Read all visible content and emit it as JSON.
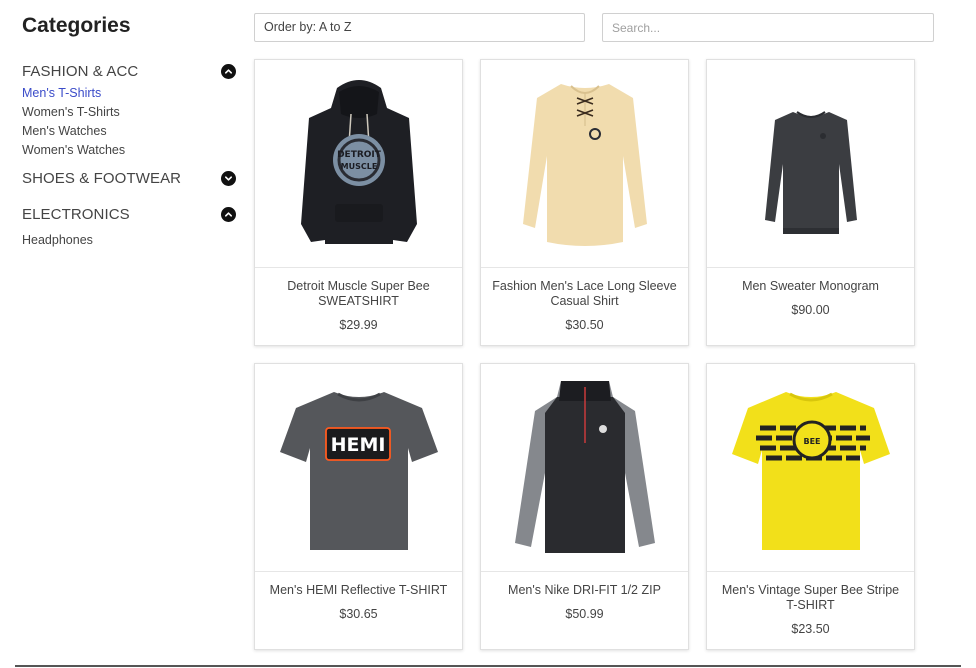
{
  "sidebar": {
    "title": "Categories",
    "groups": [
      {
        "label": "FASHION & ACC",
        "icon": "chevron-up-icon",
        "items": [
          "Men's T-Shirts",
          "Women's T-Shirts",
          "Men's Watches",
          "Women's Watches"
        ],
        "active_item": "Men's T-Shirts"
      },
      {
        "label": "SHOES & FOOTWEAR",
        "icon": "chevron-down-icon",
        "items": []
      },
      {
        "label": "ELECTRONICS",
        "icon": "chevron-up-icon",
        "items": [
          "Headphones"
        ]
      }
    ]
  },
  "toolbar": {
    "order_by": "Order by: A to Z",
    "search_placeholder": "Search..."
  },
  "products": [
    {
      "name": "Detroit Muscle Super Bee SWEATSHIRT",
      "price": "$29.99"
    },
    {
      "name": "Fashion Men's Lace Long Sleeve Casual Shirt",
      "price": "$30.50"
    },
    {
      "name": "Men Sweater Monogram",
      "price": "$90.00"
    },
    {
      "name": "Men's HEMI Reflective T-SHIRT",
      "price": "$30.65"
    },
    {
      "name": "Men's Nike DRI-FIT 1/2 ZIP",
      "price": "$50.99"
    },
    {
      "name": "Men's Vintage Super Bee Stripe T-SHIRT",
      "price": "$23.50"
    }
  ],
  "colors": {
    "active_link": "#3b4cc9",
    "text": "#444444",
    "border": "#e0e0e0"
  }
}
